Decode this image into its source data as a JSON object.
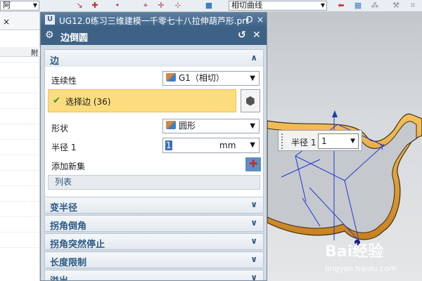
{
  "toolbar": {
    "combo_left": "阿",
    "combo_right": "相切曲线"
  },
  "navigator": {
    "close_glyph": "×",
    "column_label": "附"
  },
  "window": {
    "title": "UG12.0练习三维建模一千零七十八拉伸葫芦形.prt",
    "pin_glyph": "D",
    "close_glyph": "×"
  },
  "dialog": {
    "title": "边倒圆",
    "reset_glyph": "↺",
    "close_glyph": "✕",
    "edge_group": {
      "title": "边",
      "continuity_label": "连续性",
      "continuity_value": "G1（相切）",
      "select_label": "选择边 (36)",
      "shape_label": "形状",
      "shape_value": "圆形",
      "radius_label": "半径 1",
      "radius_value": "1",
      "radius_unit": "mm",
      "add_new_set_label": "添加新集",
      "list_label": "列表"
    },
    "sections": [
      "变半径",
      "拐角倒角",
      "拐角突然停止",
      "长度限制",
      "溢出"
    ]
  },
  "viewport": {
    "radius_popup_label": "半径 1",
    "radius_popup_value": "1",
    "watermark_brand": "Bai经验",
    "watermark_url": "jingyan.baidu.com"
  },
  "colors": {
    "accent_blue": "#3d6285",
    "selection_yellow": "#fbdc7e",
    "model_orange": "#e8a22c"
  }
}
